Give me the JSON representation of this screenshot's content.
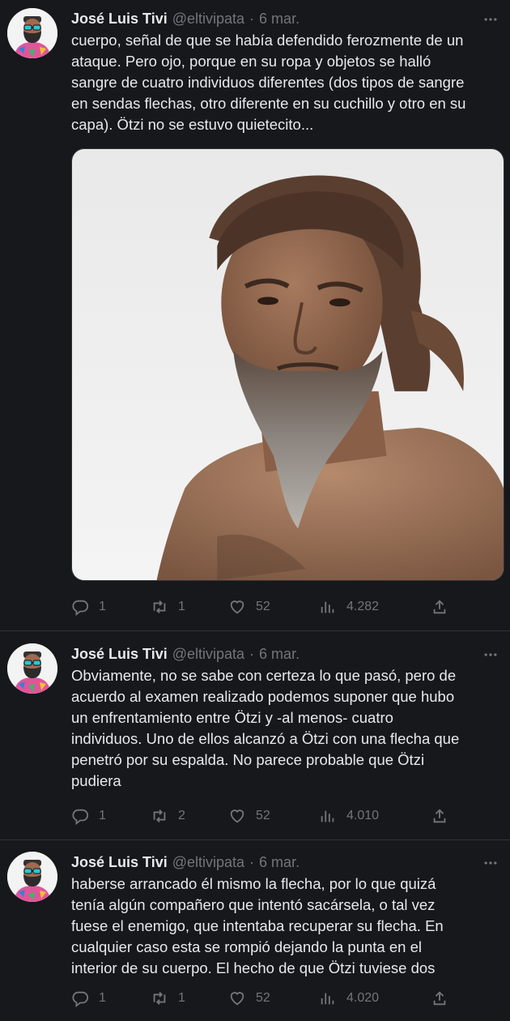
{
  "colors": {
    "background": "#16181c",
    "text": "#e7e9ea",
    "muted": "#71767b",
    "divider": "#2f3336"
  },
  "tweets": [
    {
      "author": {
        "name": "José Luis Tivi",
        "handle": "@eltivipata",
        "separator": "·",
        "date": "6 mar."
      },
      "text": "cuerpo, señal de que se había defendido ferozmente de un\nataque. Pero ojo, porque en su ropa y objetos se halló\nsangre de cuatro individuos diferentes (dos tipos de sangre\nen sendas flechas, otro diferente en su cuchillo y otro en su\ncapa). Ötzi no se estuvo quietecito...",
      "media": "photo of a bearded prehistoric man reconstruction",
      "stats": {
        "replies": "1",
        "retweets": "1",
        "likes": "52",
        "views": "4.282"
      }
    },
    {
      "author": {
        "name": "José Luis Tivi",
        "handle": "@eltivipata",
        "separator": "·",
        "date": "6 mar."
      },
      "text": "Obviamente, no se sabe con certeza lo que pasó, pero de\nacuerdo al examen realizado podemos suponer que hubo\nun enfrentamiento entre Ötzi y -al menos- cuatro\nindividuos. Uno de ellos alcanzó a Ötzi con una flecha que\npenetró por su espalda. No parece probable que Ötzi\npudiera",
      "stats": {
        "replies": "1",
        "retweets": "2",
        "likes": "52",
        "views": "4.010"
      }
    },
    {
      "author": {
        "name": "José Luis Tivi",
        "handle": "@eltivipata",
        "separator": "·",
        "date": "6 mar."
      },
      "text": "haberse arrancado él mismo la flecha, por lo que quizá\ntenía algún compañero que intentó sacársela, o tal vez\nfuese el enemigo, que intentaba recuperar su flecha. En\ncualquier caso esta se rompió dejando la punta en el\ninterior de su cuerpo. El hecho de que Ötzi tuviese dos",
      "stats": {
        "replies": "1",
        "retweets": "1",
        "likes": "52",
        "views": "4.020"
      }
    }
  ],
  "icons": [
    "avatar-illustration",
    "more-icon",
    "reply-icon",
    "retweet-icon",
    "like-icon",
    "views-icon",
    "share-icon"
  ]
}
